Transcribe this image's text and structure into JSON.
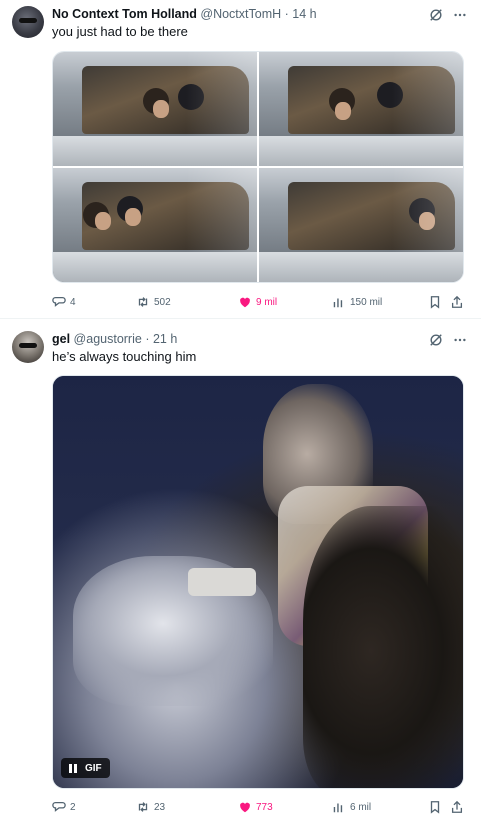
{
  "tweets": [
    {
      "display_name": "No Context Tom Holland",
      "handle": "@NoctxtTomH",
      "time": "· 14 h",
      "text": "you just had to be there",
      "media_type": "photo-grid",
      "stats": {
        "replies": "4",
        "reposts": "502",
        "likes": "9 mil",
        "views": "150 mil"
      },
      "liked": true
    },
    {
      "display_name": "gel",
      "handle": "@agustorrie",
      "time": "· 21 h",
      "text": "he’s always touching him",
      "media_type": "gif",
      "gif_label": "GIF",
      "stats": {
        "replies": "2",
        "reposts": "23",
        "likes": "773",
        "views": "6 mil"
      },
      "liked": true
    }
  ],
  "icons": [
    "grok-icon",
    "more-icon",
    "reply-icon",
    "retweet-icon",
    "heart-icon",
    "views-icon",
    "bookmark-icon",
    "share-icon",
    "pause-icon"
  ],
  "colors": {
    "like": "#f91880",
    "muted": "#536471",
    "text": "#0f1419"
  }
}
